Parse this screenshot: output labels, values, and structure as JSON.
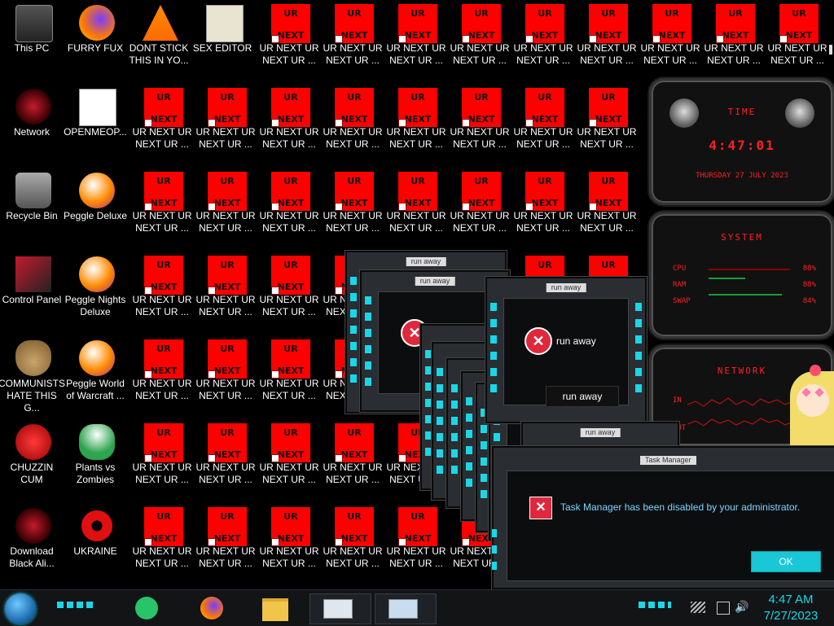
{
  "desktop": {
    "icons": [
      {
        "label": "This PC",
        "icon": "this-pc-icon"
      },
      {
        "label": "FURRY FUX",
        "icon": "firefox-icon"
      },
      {
        "label": "DONT STICK THIS IN YO...",
        "icon": "vlc-icon"
      },
      {
        "label": "SEX EDITOR",
        "icon": "hxd-editor-icon"
      },
      {
        "label": "Network",
        "icon": "network-icon"
      },
      {
        "label": "OPENMEOP...",
        "icon": "document-icon"
      },
      {
        "label": "Recycle Bin",
        "icon": "recycle-bin-icon"
      },
      {
        "label": "Peggle Deluxe",
        "icon": "peggle-icon"
      },
      {
        "label": "Control Panel",
        "icon": "control-panel-icon"
      },
      {
        "label": "Peggle Nights Deluxe",
        "icon": "peggle-icon"
      },
      {
        "label": "COMMUNISTS HATE THIS G...",
        "icon": "money-bag-icon"
      },
      {
        "label": "Peggle World of Warcraft ...",
        "icon": "peggle-icon"
      },
      {
        "label": "CHUZZIN CUM",
        "icon": "chuzzle-icon"
      },
      {
        "label": "Plants vs Zombies",
        "icon": "plant-icon"
      },
      {
        "label": "Download Black Ali...",
        "icon": "alien-icon"
      },
      {
        "label": "UKRAINE",
        "icon": "radiation-icon"
      }
    ],
    "ur_tile": {
      "top": "UR",
      "bottom": "NEXT",
      "label": "UR NEXT UR NEXT UR ..."
    }
  },
  "widget": {
    "time_title": "TIME",
    "time": "4:47:01",
    "date": "THURSDAY 27 JULY 2023",
    "system_title": "SYSTEM",
    "cpu_label": "CPU",
    "cpu_value": "88%",
    "ram_label": "RAM",
    "ram_value": "88%",
    "swap_label": "SWAP",
    "swap_value": "84%",
    "network_title": "NETWORK",
    "in_label": "IN",
    "out_label": "OUT"
  },
  "dialogs": {
    "runaway_caption": "run away",
    "runaway_message": "run away",
    "runaway_button": "run away",
    "tm_caption": "Task Manager",
    "tm_message": "Task Manager has been disabled by your administrator.",
    "tm_ok": "OK"
  },
  "taskbar": {
    "time": "4:47 AM",
    "date": "7/27/2023",
    "accent": "#19d7e8"
  }
}
